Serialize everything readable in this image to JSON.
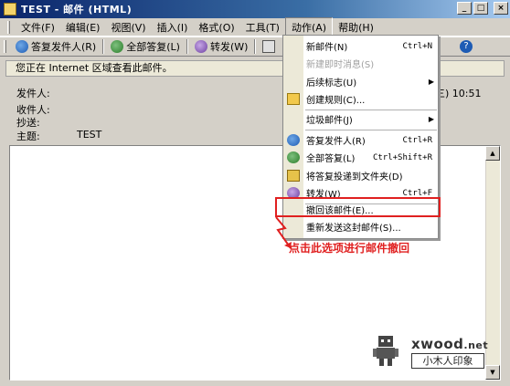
{
  "window": {
    "title": "TEST - 邮件 (HTML)",
    "controls": [
      "_",
      "□",
      "×"
    ]
  },
  "menubar": {
    "items": [
      {
        "label": "文件(F)"
      },
      {
        "label": "编辑(E)"
      },
      {
        "label": "视图(V)"
      },
      {
        "label": "插入(I)"
      },
      {
        "label": "格式(O)"
      },
      {
        "label": "工具(T)"
      },
      {
        "label": "动作(A)",
        "active": true
      },
      {
        "label": "帮助(H)"
      }
    ]
  },
  "toolbar": {
    "reply_label": "答复发件人(R)",
    "reply_all_label": "全部答复(L)",
    "forward_label": "转发(W)",
    "help_glyph": "?"
  },
  "infobar": {
    "text": "您正在 Internet 区域查看此邮件。"
  },
  "message": {
    "from_label": "发件人:",
    "to_label": "收件人:",
    "cc_label": "抄送:",
    "subject_label": "主题:",
    "subject_value": "TEST",
    "date_fragment": "三) 10:51"
  },
  "dropdown": {
    "items": [
      {
        "label": "新邮件(N)",
        "shortcut": "Ctrl+N"
      },
      {
        "label": "新建即时消息(S)",
        "disabled": true
      },
      {
        "label": "后续标志(U)",
        "submenu": true
      },
      {
        "label": "创建规则(C)...",
        "icon": "rule-icon"
      },
      {
        "label": "垃圾邮件(J)",
        "submenu": true
      },
      {
        "label": "答复发件人(R)",
        "shortcut": "Ctrl+R",
        "icon": "reply-icon"
      },
      {
        "label": "全部答复(L)",
        "shortcut": "Ctrl+Shift+R",
        "icon": "reply-all-icon"
      },
      {
        "label": "将答复投递到文件夹(D)",
        "icon": "folder-icon"
      },
      {
        "label": "转发(W)",
        "shortcut": "Ctrl+F",
        "icon": "forward-icon"
      },
      {
        "label": "撤回该邮件(E)...",
        "highlighted": true
      },
      {
        "label": "重新发送这封邮件(S)..."
      }
    ]
  },
  "annotation": {
    "text": "点击此选项进行邮件撤回",
    "color": "#e02020"
  },
  "watermark": {
    "site": "xwood.net",
    "site_main": "xwood",
    "site_suffix": ".net",
    "name": "小木人印象"
  },
  "colors": {
    "title_gradient_start": "#0a246a",
    "title_gradient_end": "#a6caf0",
    "window_face": "#d4d0c8",
    "menu_strip": "#ece9d8",
    "annotation_red": "#e02020"
  }
}
